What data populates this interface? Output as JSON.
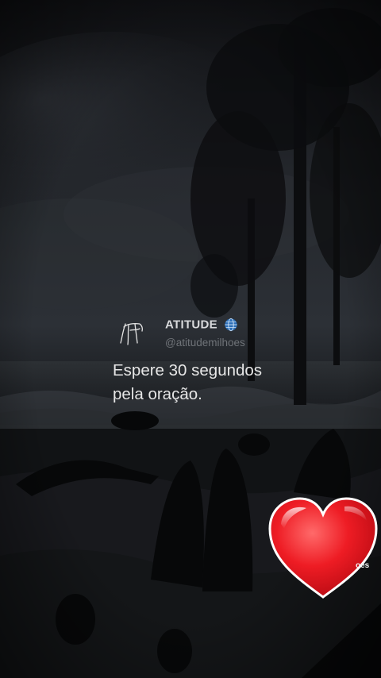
{
  "post": {
    "author_name": "ATITUDE",
    "handle": "@atitudemilhoes",
    "text": "Espere 30 segundos\npela oração."
  },
  "overlay": {
    "partial_label": "oes"
  },
  "icons": {
    "verified": "globe-icon",
    "reaction": "heart-icon",
    "avatar": "signature-avatar"
  },
  "colors": {
    "heart": "#e8101e",
    "globe": "#2d6fb8",
    "sky": "#2a2d33",
    "ground": "#0e1012"
  }
}
